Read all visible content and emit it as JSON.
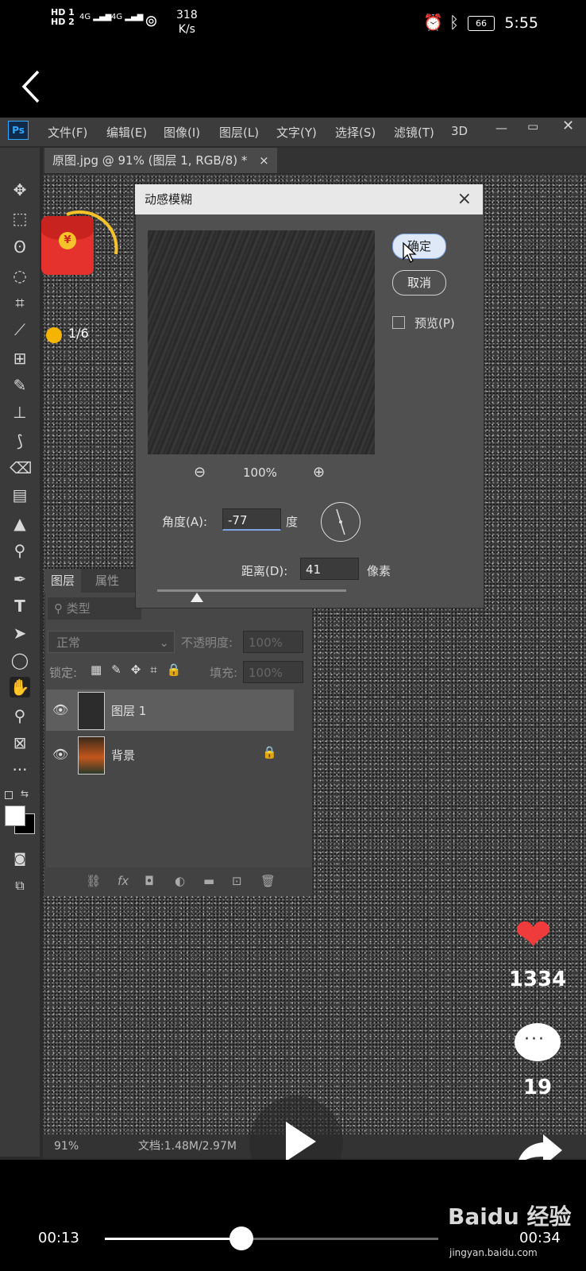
{
  "status_bar": {
    "hd1": "HD 1",
    "hd2": "HD 2",
    "sig1": "4G",
    "sig2": "4G",
    "speed_value": "318",
    "speed_unit": "K/s",
    "battery": "66",
    "time": "5:55"
  },
  "photoshop": {
    "logo": "Ps",
    "menu": [
      "文件(F)",
      "编辑(E)",
      "图像(I)",
      "图层(L)",
      "文字(Y)",
      "选择(S)",
      "滤镜(T)",
      "3D"
    ],
    "tab_title": "原图.jpg @ 91% (图层 1, RGB/8) *",
    "tab_close": "×",
    "status_zoom": "91%",
    "status_doc": "文档:1.48M/2.97M"
  },
  "dialog": {
    "title": "动感模糊",
    "close": "×",
    "ok": "确定",
    "cancel": "取消",
    "preview_label": "预览(P)",
    "zoom": "100%",
    "angle_label": "角度(A):",
    "angle_value": "-77",
    "angle_unit": "度",
    "distance_label": "距离(D):",
    "distance_value": "41",
    "distance_unit": "像素"
  },
  "layers_panel": {
    "tab_layers": "图层",
    "tab_properties": "属性",
    "search_placeholder": "类型",
    "blend_mode": "正常",
    "opacity_label": "不透明度:",
    "opacity_value": "100%",
    "lock_label": "锁定:",
    "fill_label": "填充:",
    "fill_value": "100%",
    "layers": [
      {
        "name": "图层 1"
      },
      {
        "name": "背景"
      }
    ],
    "bottom_fx": "fx"
  },
  "overlay": {
    "red_packet_symbol": "¥",
    "coin_progress": "1/6"
  },
  "social": {
    "likes": "1334",
    "comments": "19",
    "share": "分享"
  },
  "player": {
    "current_time": "00:13",
    "total_time": "00:34",
    "progress": 0.41
  },
  "watermark": {
    "brand": "Baidu 经验",
    "url": "jingyan.baidu.com"
  }
}
